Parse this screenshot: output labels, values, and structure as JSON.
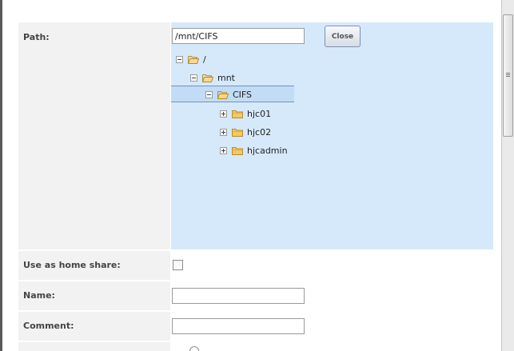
{
  "form": {
    "path_label": "Path:",
    "path_value": "/mnt/CIFS",
    "close_label": "Close",
    "home_share_label": "Use as home share:",
    "name_label": "Name:",
    "name_value": "",
    "comment_label": "Comment:",
    "comment_value": ""
  },
  "tree": {
    "nodes": [
      {
        "label": "/",
        "toggle": "minus",
        "icon": "folder-open-icon"
      },
      {
        "label": "mnt",
        "toggle": "minus",
        "icon": "folder-open-icon"
      },
      {
        "label": "CIFS",
        "toggle": "minus",
        "icon": "folder-open-icon",
        "selected": true
      },
      {
        "label": "hjc01",
        "toggle": "plus",
        "icon": "folder-icon"
      },
      {
        "label": "hjc02",
        "toggle": "plus",
        "icon": "folder-icon"
      },
      {
        "label": "hjcadmin",
        "toggle": "plus",
        "icon": "folder-icon"
      }
    ]
  },
  "colors": {
    "tree_background": "#d6e9fb",
    "label_background": "#f2f2f2",
    "selected_row": "#c2dcf5",
    "folder": "#f5c862"
  }
}
